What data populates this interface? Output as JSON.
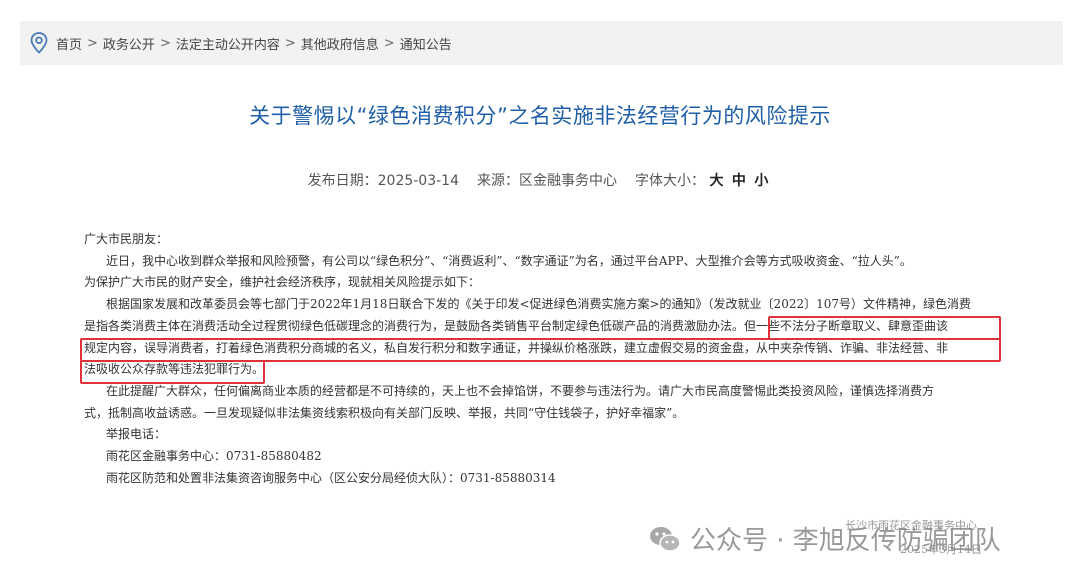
{
  "breadcrumb": {
    "items": [
      "首页",
      "政务公开",
      "法定主动公开内容",
      "其他政府信息",
      "通知公告"
    ],
    "separator": ">"
  },
  "article": {
    "title": "关于警惕以“绿色消费积分”之名实施非法经营行为的风险提示",
    "meta": {
      "date_label": "发布日期：",
      "date": "2025-03-14",
      "source_label": "来源：",
      "source": "区金融事务中心",
      "fontsize_label": "字体大小：",
      "size_large": "大",
      "size_medium": "中",
      "size_small": "小"
    },
    "body_lines": [
      "广大市民朋友：",
      "近日，我中心收到群众举报和风险预警，有公司以“绿色积分”、“消费返利”、“数字通证”为名，通过平台APP、大型推介会等方式吸收资金、“拉人头”。",
      "为保护广大市民的财产安全，维护社会经济秩序，现就相关风险提示如下：",
      "根据国家发展和改革委员会等七部门于2022年1月18日联合下发的《关于印发<促进绿色消费实施方案>的通知》（发改就业〔2022〕107号）文件精神，绿色消费",
      "是指各类消费主体在消费活动全过程贯彻绿色低碳理念的消费行为，是鼓励各类销售平台制定绿色低碳产品的消费激励办法。但一些不法分子断章取义、肆意歪曲该",
      "规定内容，误导消费者，打着绿色消费积分商城的名义，私自发行积分和数字通证，并操纵价格涨跌，建立虚假交易的资金盘，从中夹杂传销、诈骗、非法经营、非",
      "法吸收公众存款等违法犯罪行为。",
      "在此提醒广大群众，任何偏离商业本质的经营都是不可持续的，天上也不会掉馅饼，不要参与违法行为。请广大市民高度警惕此类投资风险，谨慎选择消费方",
      "式，抵制高收益诱惑。一旦发现疑似非法集资线索积极向有关部门反映、举报，共同“守住钱袋子，护好幸福家”。",
      "举报电话：",
      "雨花区金融事务中心：0731-85880482",
      "雨花区防范和处置非法集资咨询服务中心（区公安分局经侦大队）：0731-85880314"
    ],
    "stamp_text": "长沙市雨花区金融事务中心",
    "stamp_date": "2025年3月14日"
  },
  "watermark": {
    "text": "公众号 · 李旭反传防骗团队",
    "icon": "wechat-icon"
  },
  "colors": {
    "title": "#1f5fa8",
    "highlight": "#e0323a",
    "breadcrumb_bg": "#f2f2f2"
  }
}
